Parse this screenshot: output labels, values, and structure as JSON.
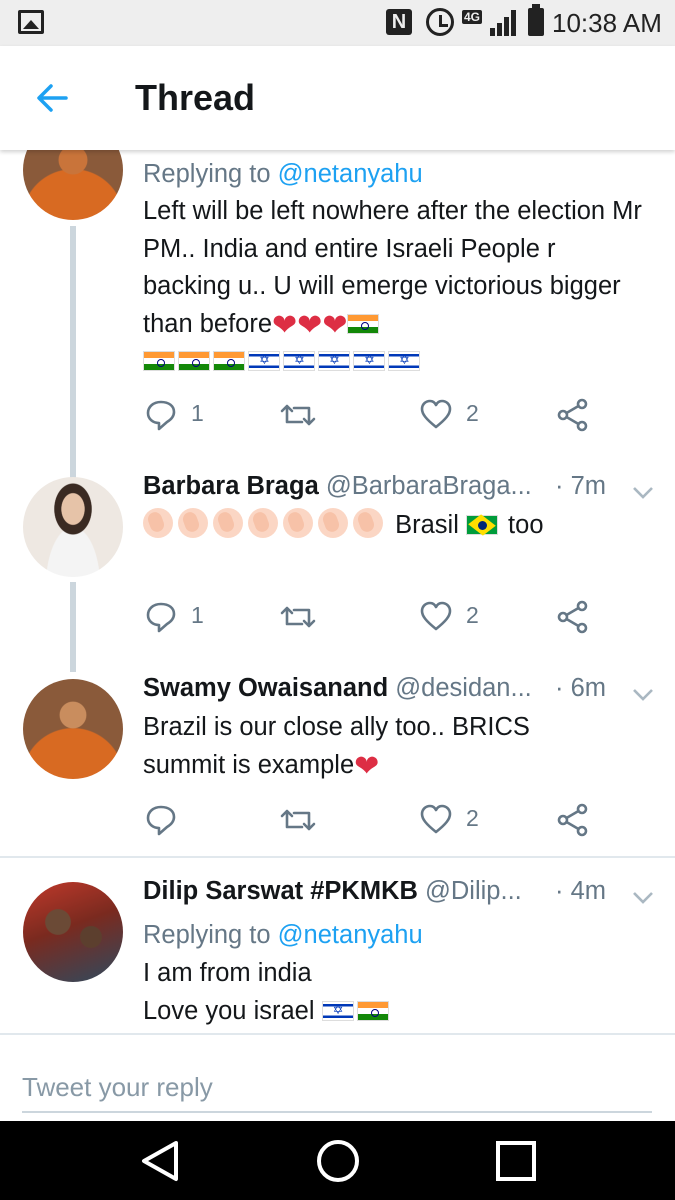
{
  "status_bar": {
    "time": "10:38 AM",
    "network": "4G",
    "icons": [
      "gallery-icon",
      "nfc-icon",
      "alarm-icon",
      "signal-icon",
      "battery-icon"
    ]
  },
  "header": {
    "title": "Thread",
    "back_icon": "arrow-left-icon"
  },
  "colors": {
    "accent": "#1da1f2",
    "text": "#14171a",
    "muted": "#657786",
    "divider": "#e1e8ed",
    "heart": "#dd2e44"
  },
  "tweets": [
    {
      "replying_label": "Replying to",
      "replying_handle": "@netanyahu",
      "text": "Left will be left nowhere after the election Mr PM.. India and entire Israeli People r backing u.. U will emerge victorious bigger than before",
      "emojis": [
        "red-heart",
        "red-heart",
        "red-heart",
        "flag-india",
        "flag-india",
        "flag-india",
        "flag-india",
        "flag-israel",
        "flag-israel",
        "flag-israel",
        "flag-israel",
        "flag-israel"
      ],
      "replies": "1",
      "likes": "2"
    },
    {
      "name": "Barbara Braga",
      "handle": "@BarbaraBraga...",
      "time": "· 7m",
      "text_before": "",
      "text_word": "Brasil",
      "text_after": "too",
      "emojis": [
        "clapping-hands",
        "clapping-hands",
        "clapping-hands",
        "clapping-hands",
        "clapping-hands",
        "clapping-hands",
        "clapping-hands",
        "flag-brazil"
      ],
      "replies": "1",
      "likes": "2"
    },
    {
      "name": "Swamy Owaisanand",
      "handle": "@desidan...",
      "time": "· 6m",
      "text": "Brazil is our close ally too.. BRICS summit is example",
      "emojis": [
        "red-heart"
      ],
      "replies": "",
      "likes": "2"
    },
    {
      "name": "Dilip Sarswat #PKMKB",
      "handle": "@Dilip...",
      "time": "· 4m",
      "replying_label": "Replying to",
      "replying_handle": "@netanyahu",
      "line1": "I am from india",
      "line2": "Love you israel",
      "emojis": [
        "flag-israel",
        "flag-india"
      ]
    }
  ],
  "reply_box": {
    "placeholder": "Tweet your reply"
  },
  "nav": {
    "back": "triangle-back-icon",
    "home": "circle-home-icon",
    "recents": "square-recents-icon"
  }
}
